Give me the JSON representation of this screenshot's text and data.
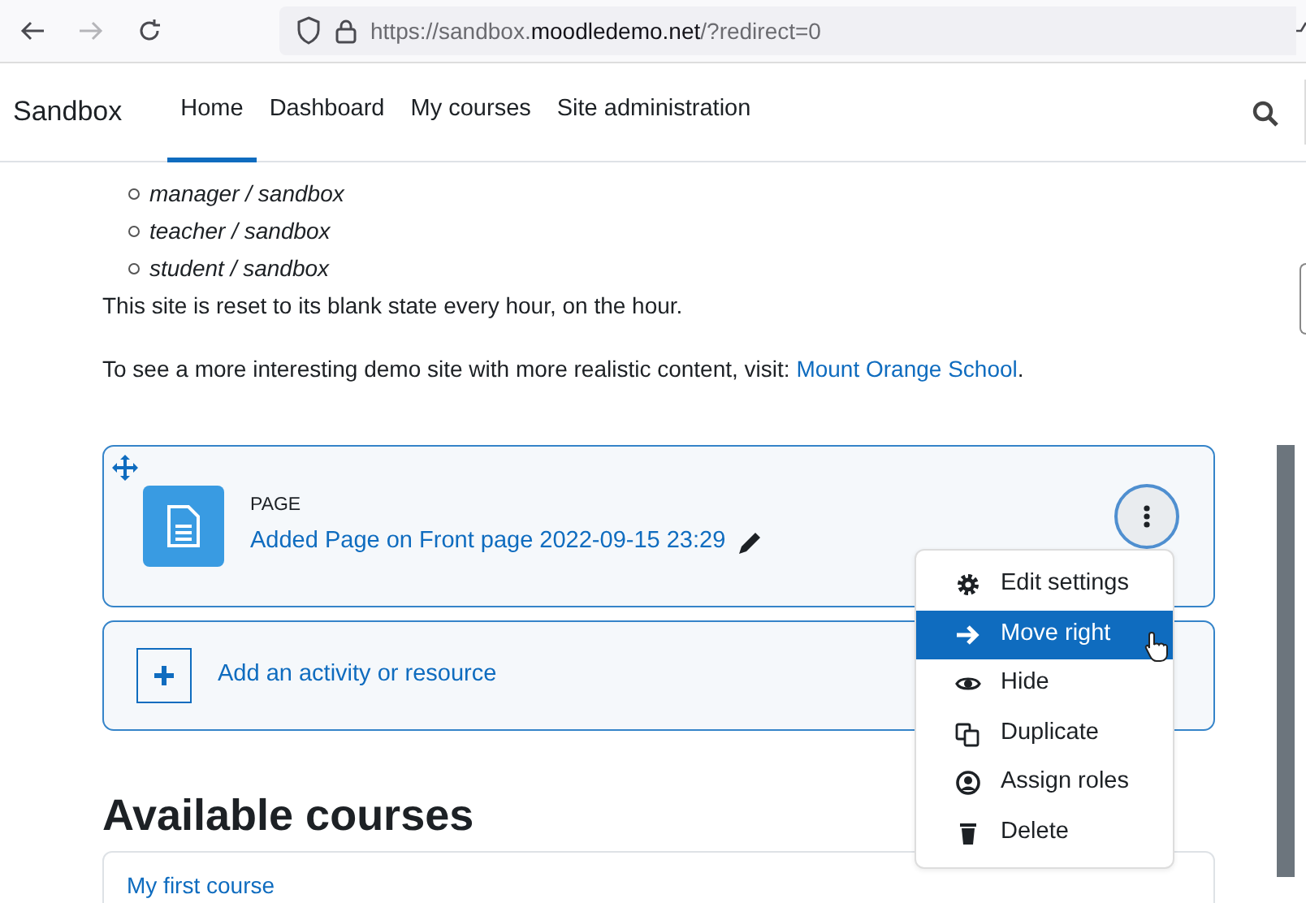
{
  "browser": {
    "nav_buttons": [
      {
        "kind": "back",
        "disabled": false
      },
      {
        "kind": "forward",
        "disabled": true
      },
      {
        "kind": "reload",
        "disabled": false
      }
    ],
    "url": {
      "prefix": "https://sandbox.",
      "domain": "moodledemo.net",
      "suffix": "/?redirect=0"
    }
  },
  "navbar": {
    "brand": "Sandbox",
    "items": [
      {
        "label": "Home",
        "selected": true
      },
      {
        "label": "Dashboard",
        "selected": false
      },
      {
        "label": "My courses",
        "selected": false
      },
      {
        "label": "Site administration",
        "selected": false
      }
    ]
  },
  "accounts": [
    "manager / sandbox",
    "teacher / sandbox",
    "student / sandbox"
  ],
  "reset_note": "This site is reset to its blank state every hour, on the hour.",
  "demo_note": {
    "text": "To see a more interesting demo site with more realistic content, visit: ",
    "link": "Mount Orange School",
    "after": "."
  },
  "activity": {
    "type": "PAGE",
    "name": "Added Page on Front page 2022-09-15 23:29"
  },
  "add_activity": "Add an activity or resource",
  "menu": [
    {
      "kind": "settings",
      "label": "Edit settings",
      "selected": false
    },
    {
      "kind": "move",
      "label": "Move right",
      "selected": true
    },
    {
      "kind": "hide",
      "label": "Hide",
      "selected": false
    },
    {
      "kind": "duplicate",
      "label": "Duplicate",
      "selected": false
    },
    {
      "kind": "roles",
      "label": "Assign roles",
      "selected": false
    },
    {
      "kind": "delete",
      "label": "Delete",
      "selected": false
    }
  ],
  "courses_heading": "Available courses",
  "courses": [
    {
      "name": "My first course"
    }
  ]
}
